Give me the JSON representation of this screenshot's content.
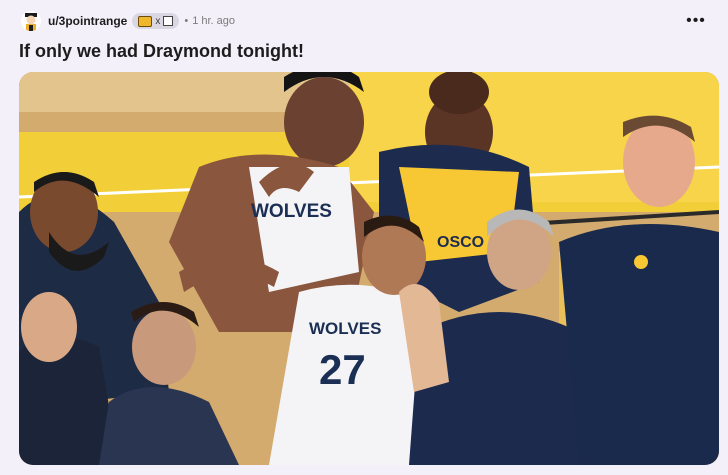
{
  "post": {
    "author": "u/3pointrange",
    "flair_separator": "x",
    "dot": "•",
    "time": "1 hr. ago",
    "more_label": "•••",
    "title": "If only we had Draymond tonight!",
    "image_icon": "photo-image",
    "jersey_text_1": "WOLVES",
    "jersey_text_2": "WOLVES",
    "jersey_number": "27",
    "jersey_text_gsw": "OSCO"
  },
  "colors": {
    "accent_flair": "#f0b62c",
    "wolves_navy": "#1b2f55",
    "warriors_gold": "#ffc72c",
    "court": "#c9a46a"
  }
}
